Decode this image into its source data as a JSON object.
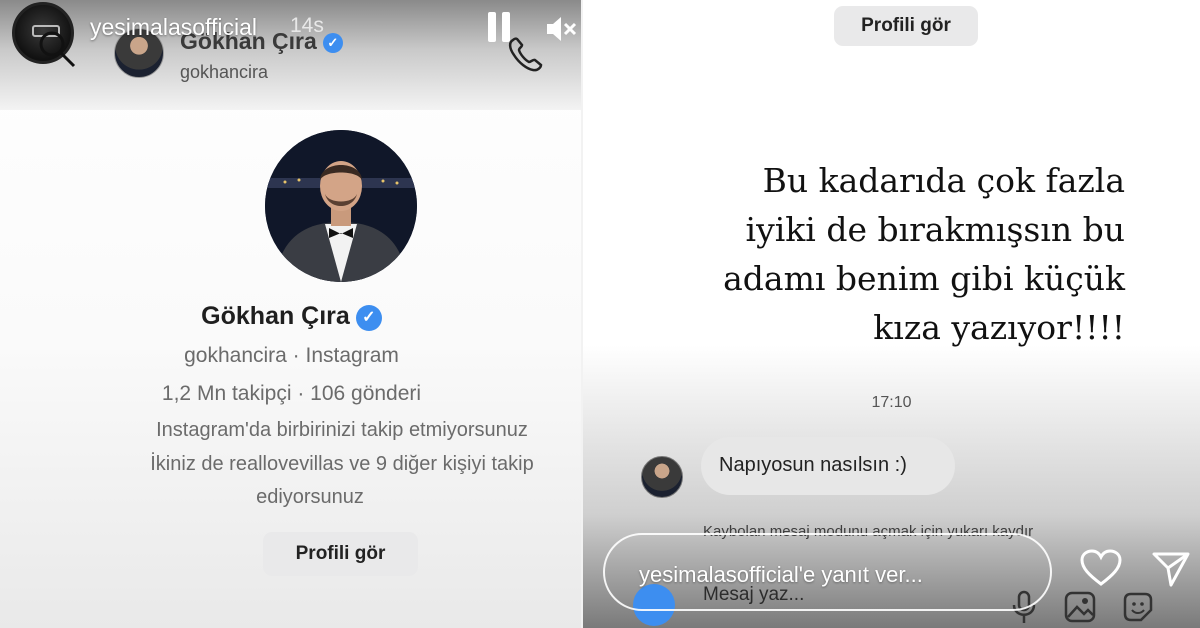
{
  "left_story": {
    "username": "yesimalasofficial",
    "time_ago": "14s",
    "dm_header": {
      "name": "Gökhan Çıra",
      "handle": "gokhancira"
    },
    "profile": {
      "name": "Gökhan Çıra",
      "handle_line": "gokhancira · Instagram",
      "stats_line": "1,2 Mn takipçi · 106 gönderi",
      "mutual_line1": "Instagram'da birbirinizi takip etmiyorsunuz",
      "mutual_line2": "İkiniz de reallovevillas ve 9 diğer kişiyi takip",
      "mutual_line3": "ediyorsunuz",
      "view_profile_label": "Profili gör"
    }
  },
  "right_story": {
    "top_button_label": "Profili gör",
    "story_text_lines": [
      "Bu kadarıda çok fazla",
      "iyiki de bırakmışsın bu",
      "adamı benim gibi küçük",
      "kıza yazıyor!!!!"
    ],
    "message_time": "17:10",
    "message_text": "Napıyosun nasılsın :)",
    "vanish_hint": "Kaybolan mesaj modunu açmak için yukarı kaydır",
    "message_placeholder": "Mesaj yaz...",
    "reply_placeholder": "yesimalasofficial'e yanıt ver..."
  },
  "colors": {
    "verified_blue": "#3d8ef0",
    "button_bg": "#e9e9ea"
  }
}
